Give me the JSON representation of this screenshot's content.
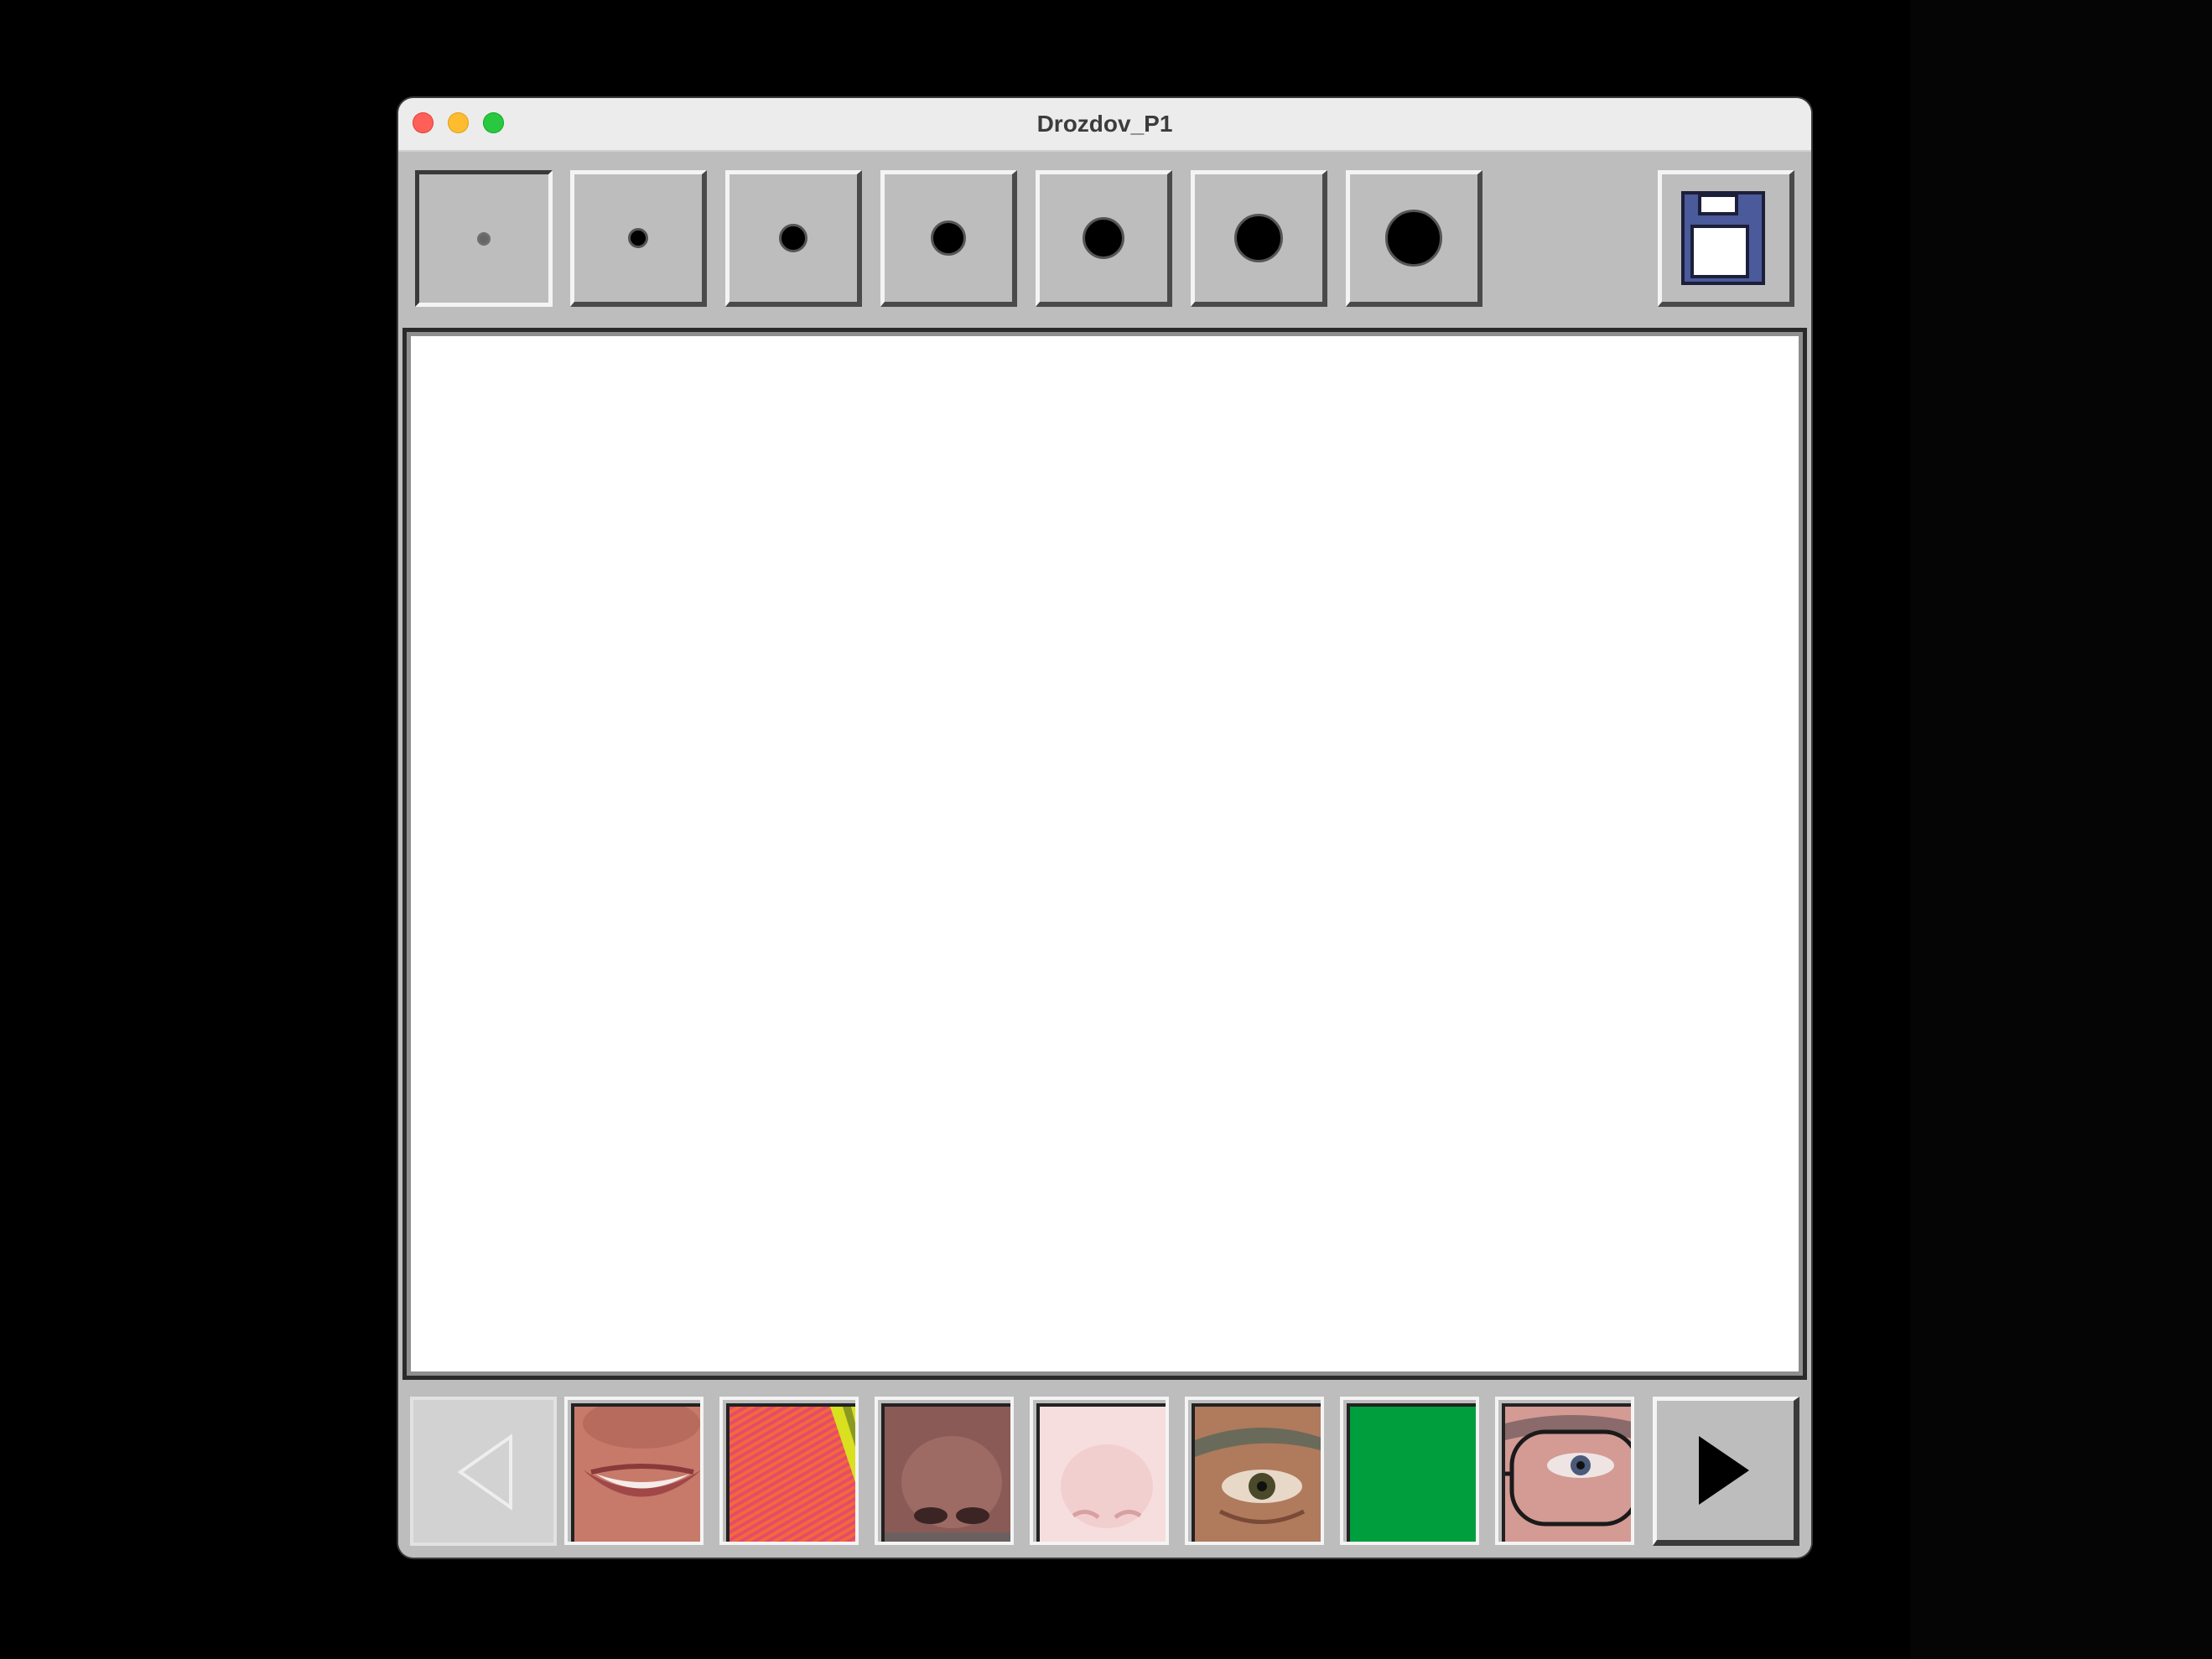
{
  "window": {
    "title": "Drozdov_P1"
  },
  "toolbar": {
    "brush_sizes": [
      {
        "name": "brush-size-1",
        "level": 1,
        "selected": true
      },
      {
        "name": "brush-size-2",
        "level": 2,
        "selected": false
      },
      {
        "name": "brush-size-3",
        "level": 3,
        "selected": false
      },
      {
        "name": "brush-size-4",
        "level": 4,
        "selected": false
      },
      {
        "name": "brush-size-5",
        "level": 5,
        "selected": false
      },
      {
        "name": "brush-size-6",
        "level": 6,
        "selected": false
      },
      {
        "name": "brush-size-7",
        "level": 7,
        "selected": false
      }
    ],
    "save_icon": "floppy-disk-icon"
  },
  "stamps": [
    {
      "name": "stamp-smiling-mouth",
      "icon": "smiling-mouth-image"
    },
    {
      "name": "stamp-orange-pattern",
      "icon": "orange-pattern-image"
    },
    {
      "name": "stamp-dark-nose",
      "icon": "nose-image"
    },
    {
      "name": "stamp-pink-nose",
      "icon": "pink-nose-image"
    },
    {
      "name": "stamp-eye",
      "icon": "eye-image"
    },
    {
      "name": "stamp-green-fill",
      "icon": "green-color",
      "color": "#009e3c"
    },
    {
      "name": "stamp-eye-glasses",
      "icon": "eye-with-glasses-image"
    }
  ],
  "nav": {
    "prev_icon": "triangle-left-icon",
    "next_icon": "triangle-right-icon",
    "prev_enabled": false
  }
}
